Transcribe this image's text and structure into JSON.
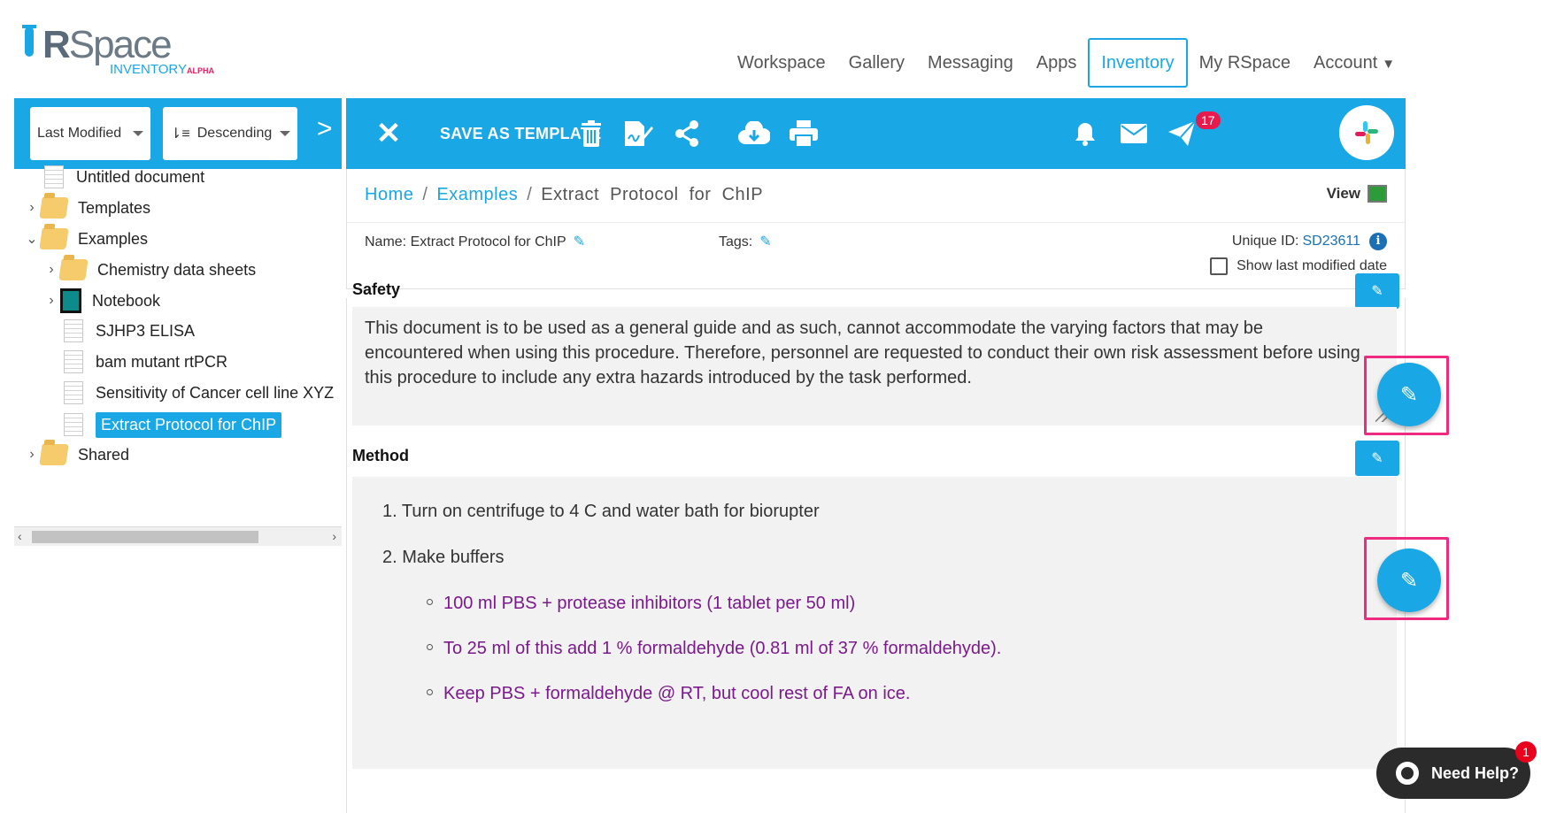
{
  "logo": {
    "brand_r": "R",
    "brand_space": "Space",
    "sub": "INVENTORY",
    "sub_tag": "ALPHA"
  },
  "nav": {
    "workspace": "Workspace",
    "gallery": "Gallery",
    "messaging": "Messaging",
    "apps": "Apps",
    "inventory": "Inventory",
    "myrspace": "My RSpace",
    "account": "Account"
  },
  "sort": {
    "by": "Last Modified",
    "direction": "Descending"
  },
  "tree": {
    "items": [
      {
        "label": "Untitled document",
        "type": "doc"
      },
      {
        "label": "Templates",
        "type": "folder"
      },
      {
        "label": "Examples",
        "type": "folder"
      },
      {
        "label": "Chemistry data sheets",
        "type": "folder"
      },
      {
        "label": "Notebook",
        "type": "notebook"
      },
      {
        "label": "SJHP3 ELISA",
        "type": "doc"
      },
      {
        "label": "bam mutant rtPCR",
        "type": "doc"
      },
      {
        "label": "Sensitivity of Cancer cell line XYZ",
        "type": "doc"
      },
      {
        "label": "Extract Protocol for ChIP",
        "type": "doc",
        "selected": true
      },
      {
        "label": "Shared",
        "type": "folder"
      }
    ]
  },
  "toolbar": {
    "save_template": "SAVE AS TEMPLATE",
    "notification_count": "17",
    "icons": [
      "close-icon",
      "trash-icon",
      "sign-icon",
      "share-icon",
      "download-icon",
      "print-icon",
      "bell-icon",
      "mail-icon",
      "send-icon",
      "slack-icon"
    ]
  },
  "breadcrumb": {
    "home": "Home",
    "examples": "Examples",
    "current": "Extract  Protocol  for  ChIP"
  },
  "doc": {
    "view": "View",
    "name": "Name: Extract Protocol for ChIP",
    "tags": "Tags:",
    "uid_label": "Unique ID:",
    "uid_value": "SD23611",
    "show_modified": "Show last modified date"
  },
  "safety": {
    "title": "Safety",
    "text": "This document is to be used as a general guide and as such, cannot accommodate the varying factors that may be encountered when using this procedure. Therefore, personnel are requested to conduct their own risk assessment before using this procedure to include any extra hazards introduced by the task performed."
  },
  "method": {
    "title": "Method",
    "steps": [
      "1. Turn on centrifuge to 4 C and water bath for biorupter",
      "2. Make buffers"
    ],
    "substeps": [
      "100 ml PBS + protease inhibitors (1 tablet per 50 ml)",
      "To 25 ml of this add 1 % formaldehyde (0.81 ml of 37 % formaldehyde).",
      "Keep PBS + formaldehyde @ RT, but cool rest of FA on ice."
    ]
  },
  "help": {
    "label": "Need Help?",
    "badge": "1"
  },
  "colors": {
    "accent": "#1aa7e5",
    "highlight": "#ee2b80",
    "link_purple": "#7b1a8c"
  }
}
